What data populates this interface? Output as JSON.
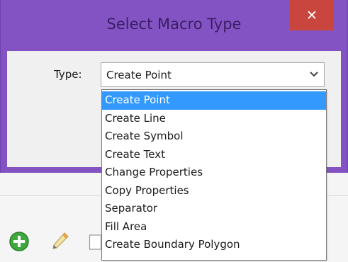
{
  "dialog": {
    "title": "Select Macro Type",
    "close_glyph": "✕",
    "type_label": "Type:",
    "selected_value": "Create Point"
  },
  "dropdown": {
    "options": [
      "Create Point",
      "Create Line",
      "Create Symbol",
      "Create Text",
      "Change Properties",
      "Copy Properties",
      "Separator",
      "Fill Area",
      "Create Boundary Polygon"
    ],
    "selected_index": 0
  },
  "toolbar": {
    "icons": [
      "add-icon",
      "pencil-icon",
      "copy-icon"
    ]
  },
  "colors": {
    "frame": "#8353c4",
    "title_text": "#3a1e63",
    "close_button": "#c8463e",
    "selection": "#3399ff",
    "add_icon": "#3eaa3e"
  }
}
